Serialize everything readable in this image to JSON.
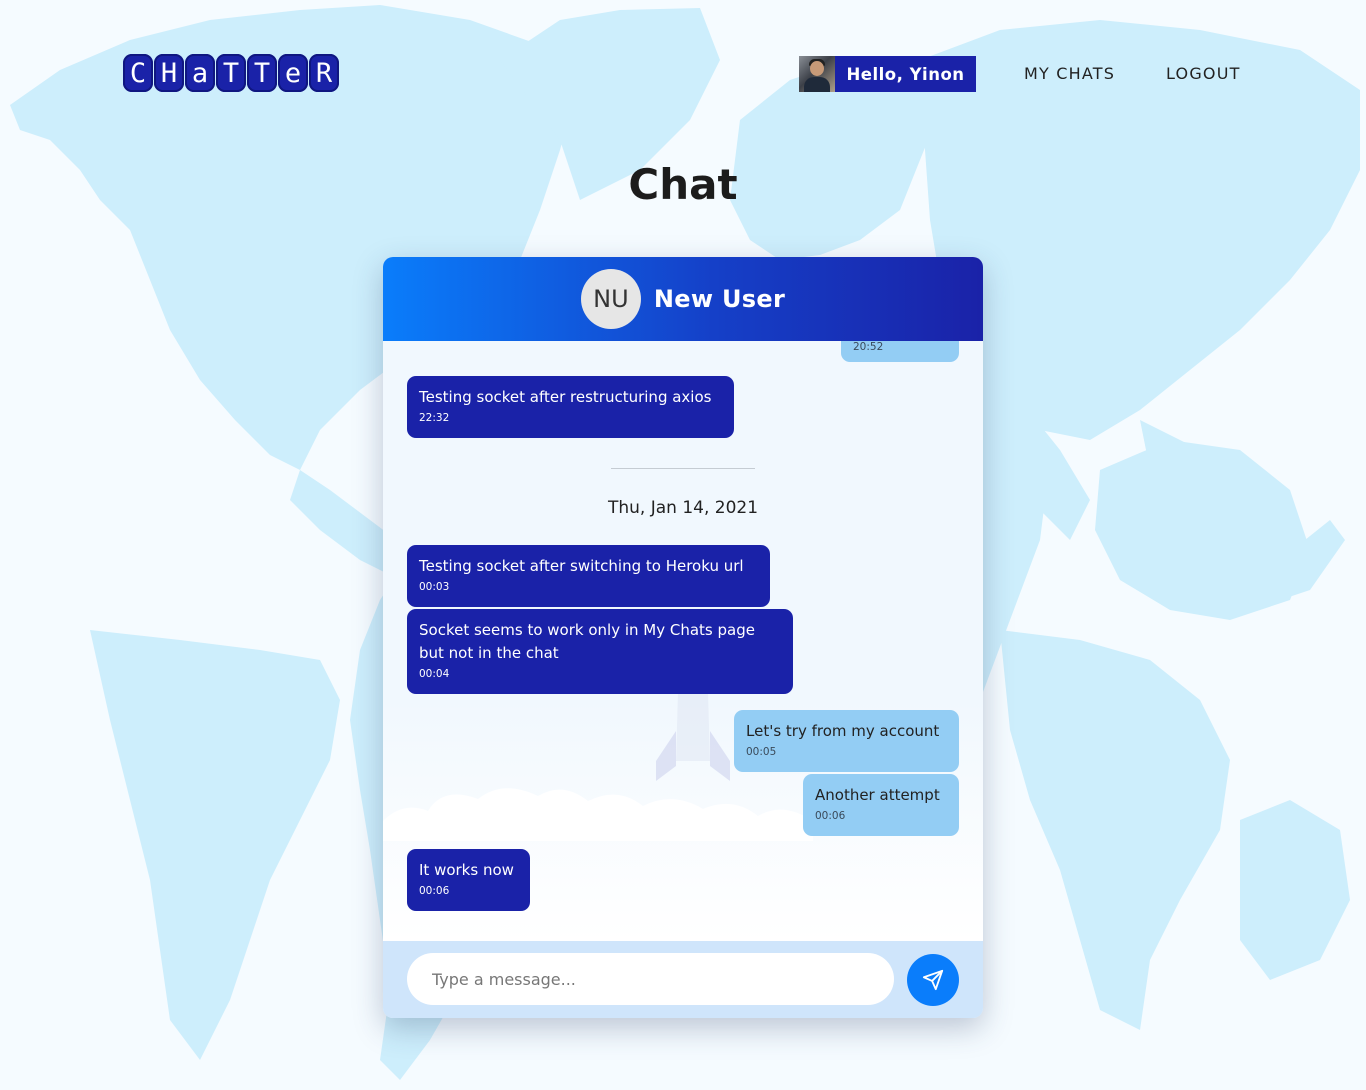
{
  "logo": {
    "letters": [
      "C",
      "H",
      "a",
      "T",
      "T",
      "e",
      "R"
    ]
  },
  "nav": {
    "greeting": "Hello, Yinon",
    "my_chats": "MY CHATS",
    "logout": "LOGOUT"
  },
  "page": {
    "title": "Chat"
  },
  "chat": {
    "contact_initials": "NU",
    "contact_name": "New User",
    "messages": [
      {
        "direction": "outgoing",
        "text": "",
        "time": "20:52"
      },
      {
        "direction": "incoming",
        "text": "Testing socket after restructuring axios",
        "time": "22:32"
      },
      {
        "direction": "incoming",
        "text": "Testing socket after switching to Heroku url",
        "time": "00:03"
      },
      {
        "direction": "incoming",
        "text": "Socket seems to work only in My Chats page but not in the chat",
        "time": "00:04"
      },
      {
        "direction": "outgoing",
        "text": "Let's try from my account",
        "time": "00:05"
      },
      {
        "direction": "outgoing",
        "text": "Another attempt",
        "time": "00:06"
      },
      {
        "direction": "incoming",
        "text": "It works now",
        "time": "00:06"
      }
    ],
    "date_separator": "Thu, Jan 14, 2021",
    "composer": {
      "placeholder": "Type a message..."
    }
  },
  "colors": {
    "primary": "#1a22a8",
    "accent": "#0a7dfb",
    "outgoing_bubble": "#93cdf4",
    "map": "#cdeefc"
  },
  "icons": [
    "send-icon",
    "user-avatar",
    "world-map-background",
    "rocket-illustration"
  ]
}
